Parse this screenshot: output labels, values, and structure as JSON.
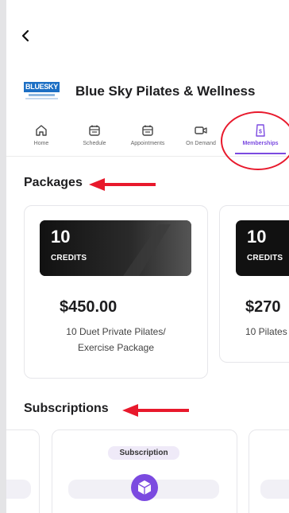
{
  "header": {
    "back_label": "back"
  },
  "brand": {
    "logo_text": "BLUESKY",
    "name": "Blue Sky Pilates & Wellness"
  },
  "tabs": [
    {
      "label": "Home",
      "icon": "home-icon"
    },
    {
      "label": "Schedule",
      "icon": "calendar-icon"
    },
    {
      "label": "Appointments",
      "icon": "calendar-icon"
    },
    {
      "label": "On Demand",
      "icon": "video-icon"
    },
    {
      "label": "Memberships",
      "icon": "membership-icon",
      "active": true
    }
  ],
  "sections": {
    "packages": "Packages",
    "subscriptions": "Subscriptions"
  },
  "packages": [
    {
      "credits": "10",
      "credits_label": "CREDITS",
      "price": "$450.00",
      "desc_line1": "10 Duet Private Pilates/",
      "desc_line2": "Exercise Package"
    },
    {
      "credits": "10",
      "credits_label": "CREDITS",
      "price": "$270",
      "desc_line1": "10 Pilates",
      "desc_line2": ""
    }
  ],
  "subscriptions": [
    {
      "badge": "Subscription",
      "icon": "cube-icon"
    }
  ],
  "colors": {
    "accent": "#7b4ae0",
    "annotation": "#e8192c",
    "brand": "#1c6fc4"
  }
}
